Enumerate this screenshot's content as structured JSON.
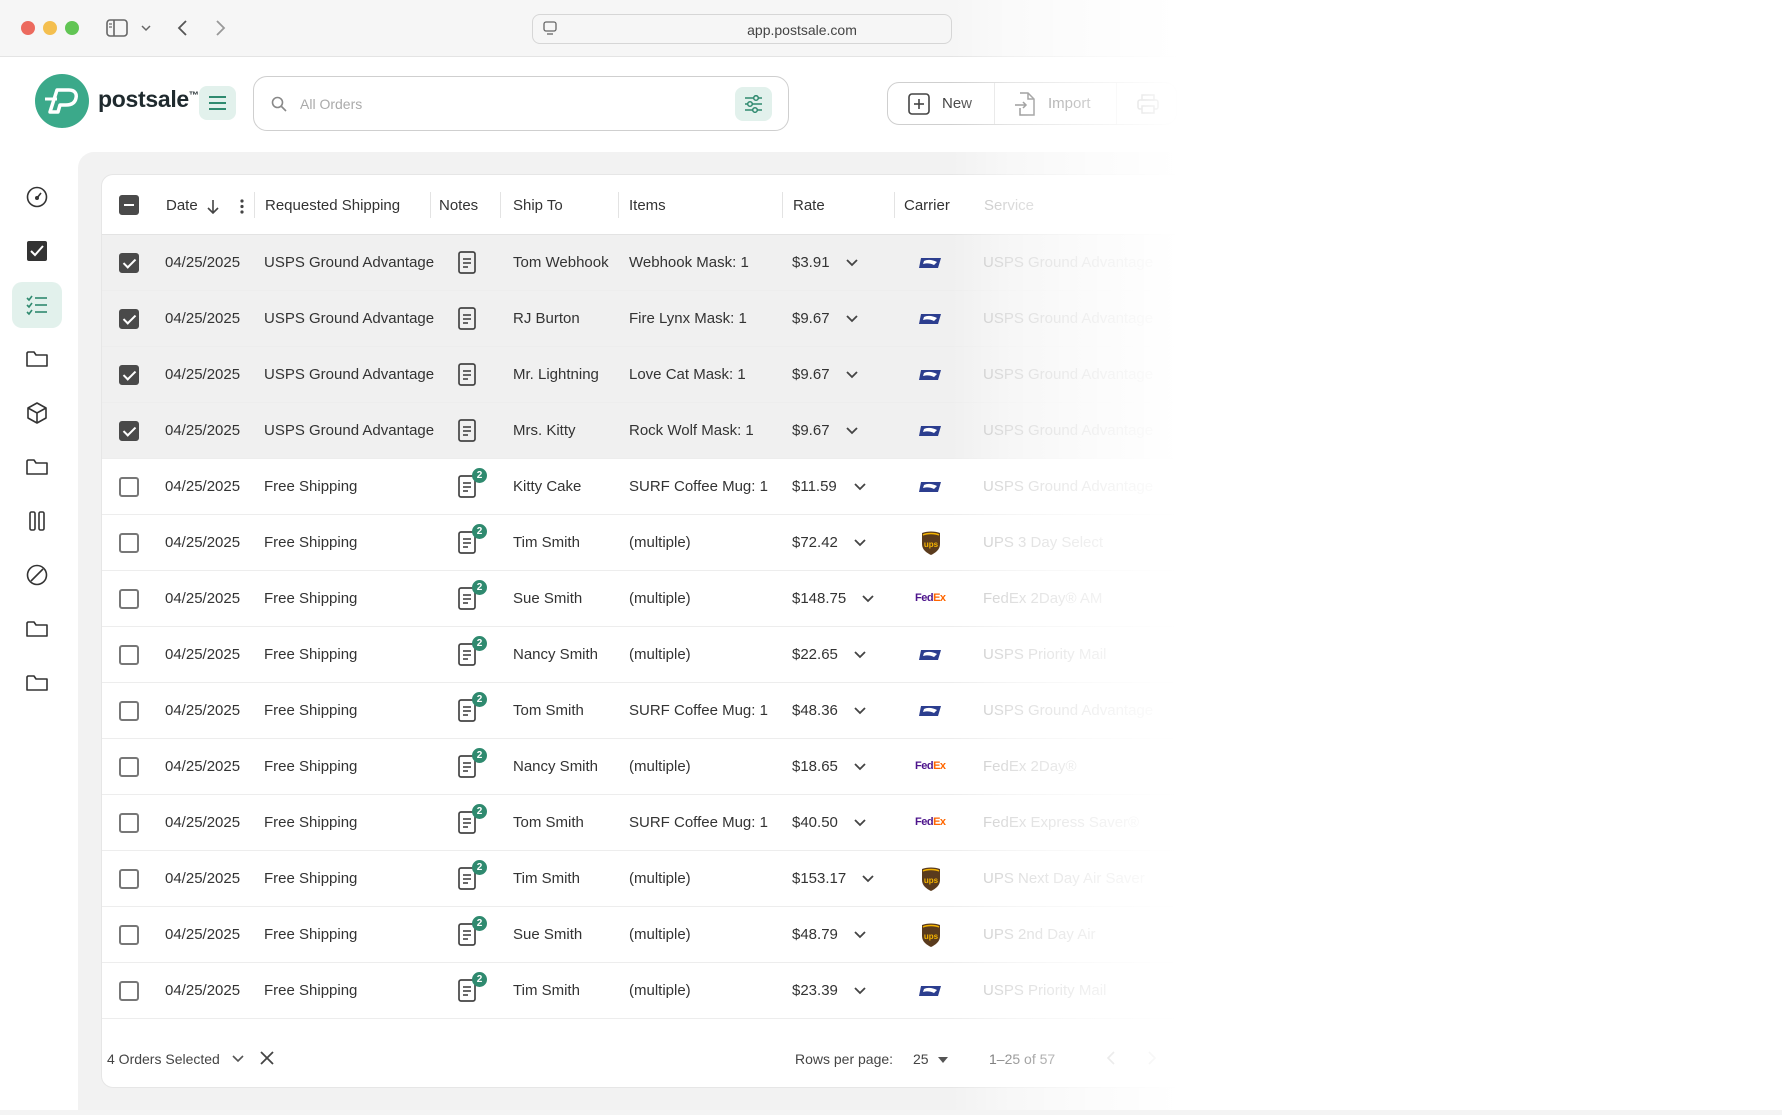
{
  "browser": {
    "url": "app.postsale.com"
  },
  "app": {
    "logo_text": "postsale",
    "logo_tm": "™"
  },
  "search": {
    "placeholder": "All Orders"
  },
  "toolbar": {
    "new_label": "New",
    "import_label": "Import"
  },
  "table": {
    "headers": {
      "date": "Date",
      "requested_shipping": "Requested Shipping",
      "notes": "Notes",
      "ship_to": "Ship To",
      "items": "Items",
      "rate": "Rate",
      "carrier": "Carrier",
      "service": "Service"
    },
    "rows": [
      {
        "selected": true,
        "date": "04/25/2025",
        "requested_shipping": "USPS Ground Advantage",
        "notes_badge": "",
        "ship_to": "Tom Webhook",
        "items": "Webhook Mask: 1",
        "rate": "$3.91",
        "carrier": "usps",
        "service": "USPS Ground Advantage"
      },
      {
        "selected": true,
        "date": "04/25/2025",
        "requested_shipping": "USPS Ground Advantage",
        "notes_badge": "",
        "ship_to": "RJ Burton",
        "items": "Fire Lynx Mask: 1",
        "rate": "$9.67",
        "carrier": "usps",
        "service": "USPS Ground Advantage"
      },
      {
        "selected": true,
        "date": "04/25/2025",
        "requested_shipping": "USPS Ground Advantage",
        "notes_badge": "",
        "ship_to": "Mr. Lightning",
        "items": "Love Cat Mask: 1",
        "rate": "$9.67",
        "carrier": "usps",
        "service": "USPS Ground Advantage"
      },
      {
        "selected": true,
        "date": "04/25/2025",
        "requested_shipping": "USPS Ground Advantage",
        "notes_badge": "",
        "ship_to": "Mrs. Kitty",
        "items": "Rock Wolf Mask: 1",
        "rate": "$9.67",
        "carrier": "usps",
        "service": "USPS Ground Advantage"
      },
      {
        "selected": false,
        "date": "04/25/2025",
        "requested_shipping": "Free Shipping",
        "notes_badge": "2",
        "ship_to": "Kitty Cake",
        "items": "SURF Coffee Mug: 1",
        "rate": "$11.59",
        "carrier": "usps",
        "service": "USPS Ground Advantage"
      },
      {
        "selected": false,
        "date": "04/25/2025",
        "requested_shipping": "Free Shipping",
        "notes_badge": "2",
        "ship_to": "Tim Smith",
        "items": "(multiple)",
        "rate": "$72.42",
        "carrier": "ups",
        "service": "UPS 3 Day Select"
      },
      {
        "selected": false,
        "date": "04/25/2025",
        "requested_shipping": "Free Shipping",
        "notes_badge": "2",
        "ship_to": "Sue Smith",
        "items": "(multiple)",
        "rate": "$148.75",
        "carrier": "fedex",
        "service": "FedEx 2Day® AM"
      },
      {
        "selected": false,
        "date": "04/25/2025",
        "requested_shipping": "Free Shipping",
        "notes_badge": "2",
        "ship_to": "Nancy Smith",
        "items": "(multiple)",
        "rate": "$22.65",
        "carrier": "usps",
        "service": "USPS Priority Mail"
      },
      {
        "selected": false,
        "date": "04/25/2025",
        "requested_shipping": "Free Shipping",
        "notes_badge": "2",
        "ship_to": "Tom Smith",
        "items": "SURF Coffee Mug: 1",
        "rate": "$48.36",
        "carrier": "usps",
        "service": "USPS Ground Advantage"
      },
      {
        "selected": false,
        "date": "04/25/2025",
        "requested_shipping": "Free Shipping",
        "notes_badge": "2",
        "ship_to": "Nancy Smith",
        "items": "(multiple)",
        "rate": "$18.65",
        "carrier": "fedex",
        "service": "FedEx 2Day®"
      },
      {
        "selected": false,
        "date": "04/25/2025",
        "requested_shipping": "Free Shipping",
        "notes_badge": "2",
        "ship_to": "Tom Smith",
        "items": "SURF Coffee Mug: 1",
        "rate": "$40.50",
        "carrier": "fedex",
        "service": "FedEx Express Saver®"
      },
      {
        "selected": false,
        "date": "04/25/2025",
        "requested_shipping": "Free Shipping",
        "notes_badge": "2",
        "ship_to": "Tim Smith",
        "items": "(multiple)",
        "rate": "$153.17",
        "carrier": "ups",
        "service": "UPS Next Day Air Saver"
      },
      {
        "selected": false,
        "date": "04/25/2025",
        "requested_shipping": "Free Shipping",
        "notes_badge": "2",
        "ship_to": "Sue Smith",
        "items": "(multiple)",
        "rate": "$48.79",
        "carrier": "ups",
        "service": "UPS 2nd Day Air"
      },
      {
        "selected": false,
        "date": "04/25/2025",
        "requested_shipping": "Free Shipping",
        "notes_badge": "2",
        "ship_to": "Tim Smith",
        "items": "(multiple)",
        "rate": "$23.39",
        "carrier": "usps",
        "service": "USPS Priority Mail"
      }
    ]
  },
  "footer": {
    "selected_count": "4 Orders Selected",
    "rows_per_page_label": "Rows per page:",
    "rows_per_page_value": "25",
    "range": "1–25 of 57"
  },
  "fedex": {
    "fe": "Fed",
    "ex": "Ex"
  },
  "colors": {
    "brand": "#3ba98a",
    "brand_light": "#e2f1ec",
    "badge": "#2f8a6f",
    "usps": "#2c3e8f",
    "ups": "#5a3b1d",
    "ups_gold": "#f5b400"
  }
}
